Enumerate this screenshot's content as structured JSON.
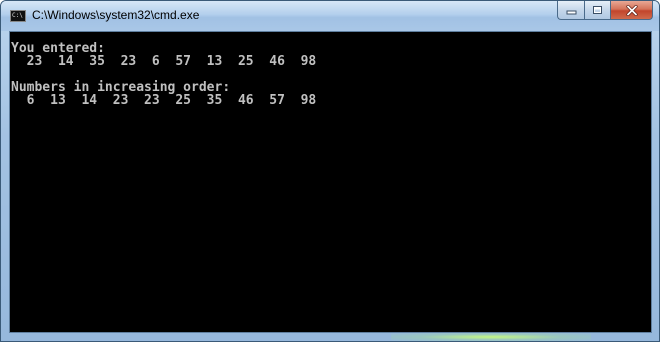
{
  "window": {
    "title": "C:\\Windows\\system32\\cmd.exe",
    "icon": "cmd-icon",
    "icon_text": "C:\\",
    "controls": {
      "minimize": "minimize-icon",
      "maximize": "maximize-icon",
      "close": "close-icon"
    }
  },
  "console": {
    "lines": [
      "You entered:",
      "  23  14  35  23  6  57  13  25  46  98",
      "",
      "Numbers in increasing order:",
      "  6  13  14  23  23  25  35  46  57  98"
    ],
    "colors": {
      "background": "#000000",
      "text": "#c0c0c0"
    }
  }
}
